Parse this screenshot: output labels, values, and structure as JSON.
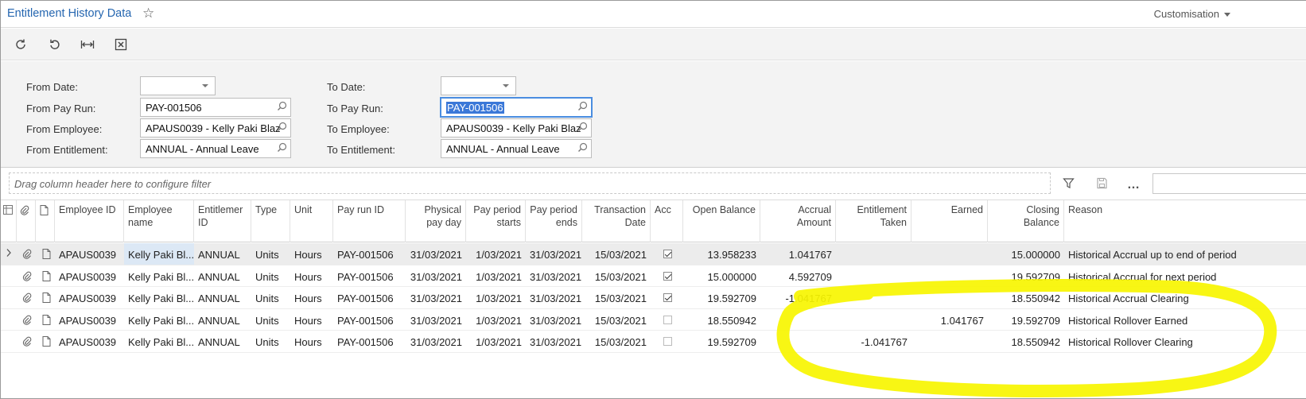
{
  "header": {
    "title": "Entitlement History Data",
    "customisation": "Customisation"
  },
  "toolbar": {
    "icons": [
      "refresh-icon",
      "undo-icon",
      "fit-columns-icon",
      "excel-export-icon"
    ]
  },
  "filters": {
    "from_date_label": "From Date:",
    "from_date_value": "",
    "from_pay_run_label": "From Pay Run:",
    "from_pay_run_value": "PAY-001506",
    "from_employee_label": "From Employee:",
    "from_employee_value": "APAUS0039 - Kelly Paki Blaz",
    "from_entitlement_label": "From Entitlement:",
    "from_entitlement_value": "ANNUAL - Annual Leave",
    "to_date_label": "To Date:",
    "to_date_value": "",
    "to_pay_run_label": "To Pay Run:",
    "to_pay_run_value": "PAY-001506",
    "to_employee_label": "To Employee:",
    "to_employee_value": "APAUS0039 - Kelly Paki Blaz",
    "to_entitlement_label": "To Entitlement:",
    "to_entitlement_value": "ANNUAL - Annual Leave"
  },
  "grid": {
    "drag_hint": "Drag column header here to configure filter",
    "columns": {
      "employee_id": "Employee ID",
      "employee_name": "Employee name",
      "entitlement_id": "Entitlemer ID",
      "type": "Type",
      "unit": "Unit",
      "pay_run_id": "Pay run ID",
      "physical_pay_day": "Physical pay day",
      "period_starts": "Pay period starts",
      "period_ends": "Pay period ends",
      "transaction_date": "Transaction Date",
      "acc": "Acc",
      "open_balance": "Open Balance",
      "accrual_amount": "Accrual Amount",
      "entitlement_taken": "Entitlement Taken",
      "earned": "Earned",
      "closing_balance": "Closing Balance",
      "reason": "Reason"
    },
    "rows": [
      {
        "employee_id": "APAUS0039",
        "employee_name": "Kelly Paki Bl...",
        "entitlement_id": "ANNUAL",
        "type": "Units",
        "unit": "Hours",
        "pay_run_id": "PAY-001506",
        "physical_pay_day": "31/03/2021",
        "period_starts": "1/03/2021",
        "period_ends": "31/03/2021",
        "transaction_date": "15/03/2021",
        "acc": true,
        "open_balance": "13.958233",
        "accrual_amount": "1.041767",
        "entitlement_taken": "",
        "earned": "",
        "closing_balance": "15.000000",
        "reason": "Historical Accrual up to end of period"
      },
      {
        "employee_id": "APAUS0039",
        "employee_name": "Kelly Paki Bl...",
        "entitlement_id": "ANNUAL",
        "type": "Units",
        "unit": "Hours",
        "pay_run_id": "PAY-001506",
        "physical_pay_day": "31/03/2021",
        "period_starts": "1/03/2021",
        "period_ends": "31/03/2021",
        "transaction_date": "15/03/2021",
        "acc": true,
        "open_balance": "15.000000",
        "accrual_amount": "4.592709",
        "entitlement_taken": "",
        "earned": "",
        "closing_balance": "19.592709",
        "reason": "Historical Accrual for next period"
      },
      {
        "employee_id": "APAUS0039",
        "employee_name": "Kelly Paki Bl...",
        "entitlement_id": "ANNUAL",
        "type": "Units",
        "unit": "Hours",
        "pay_run_id": "PAY-001506",
        "physical_pay_day": "31/03/2021",
        "period_starts": "1/03/2021",
        "period_ends": "31/03/2021",
        "transaction_date": "15/03/2021",
        "acc": true,
        "open_balance": "19.592709",
        "accrual_amount": "-1.041767",
        "entitlement_taken": "",
        "earned": "",
        "closing_balance": "18.550942",
        "reason": "Historical Accrual Clearing"
      },
      {
        "employee_id": "APAUS0039",
        "employee_name": "Kelly Paki Bl...",
        "entitlement_id": "ANNUAL",
        "type": "Units",
        "unit": "Hours",
        "pay_run_id": "PAY-001506",
        "physical_pay_day": "31/03/2021",
        "period_starts": "1/03/2021",
        "period_ends": "31/03/2021",
        "transaction_date": "15/03/2021",
        "acc": false,
        "open_balance": "18.550942",
        "accrual_amount": "",
        "entitlement_taken": "",
        "earned": "1.041767",
        "closing_balance": "19.592709",
        "reason": "Historical Rollover Earned"
      },
      {
        "employee_id": "APAUS0039",
        "employee_name": "Kelly Paki Bl...",
        "entitlement_id": "ANNUAL",
        "type": "Units",
        "unit": "Hours",
        "pay_run_id": "PAY-001506",
        "physical_pay_day": "31/03/2021",
        "period_starts": "1/03/2021",
        "period_ends": "31/03/2021",
        "transaction_date": "15/03/2021",
        "acc": false,
        "open_balance": "19.592709",
        "accrual_amount": "",
        "entitlement_taken": "-1.041767",
        "earned": "",
        "closing_balance": "18.550942",
        "reason": "Historical Rollover Clearing"
      }
    ]
  },
  "colors": {
    "title": "#2566b0",
    "panel_bg": "#f3f3f3",
    "selection": "#3b78d8",
    "highlighter": "#f7f500"
  }
}
